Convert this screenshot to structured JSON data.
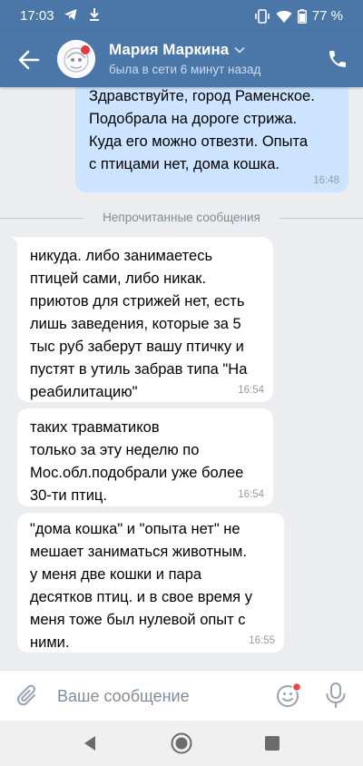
{
  "status_bar": {
    "time": "17:03",
    "battery": "77 %",
    "icons": [
      "telegram-icon",
      "download-icon",
      "vibrate-icon",
      "wifi-icon",
      "battery-icon"
    ]
  },
  "header": {
    "contact_name": "Мария Маркина",
    "contact_status": "была в сети 6 минут назад",
    "icons": [
      "back-arrow-icon",
      "chevron-down-icon",
      "phone-icon"
    ]
  },
  "messages": {
    "outgoing_1": {
      "text": "Здравствуйте, город Раменское.\nПодобрала на дороге стрижа.\nКуда его можно отвезти. Опыта\nс птицами нет, дома кошка.",
      "time": "16:48"
    },
    "divider": "Непрочитанные сообщения",
    "incoming_1": {
      "text": "никуда. либо занимаетесь\nптицей сами, либо никак.\nприютов для стрижей нет, есть\nлишь заведения, которые за 5\nтыс руб заберут вашу птичку и\nпустят в утиль забрав типа \"На\nреабилитацию\"",
      "time": "16:54"
    },
    "incoming_2": {
      "text": "таких травматиков\nтолько за эту неделю по\nМос.обл.подобрали уже более\n30-ти птиц.",
      "time": "16:54"
    },
    "incoming_3": {
      "text": "\"дома кошка\" и \"опыта нет\" не\nмешает заниматься животным.\nу меня две кошки и пара\nдесятков птиц. и в свое время у\nменя тоже был нулевой опыт с\nними.",
      "time": "16:55"
    }
  },
  "composer": {
    "placeholder": "Ваше сообщение",
    "icons": [
      "paperclip-icon",
      "sticker-icon",
      "microphone-icon"
    ]
  },
  "colors": {
    "brand": "#4a76a8",
    "outgoing_bubble": "#cce4ff",
    "incoming_bubble": "#ffffff",
    "chat_background": "#ebedf0",
    "notification_dot": "#e64646"
  }
}
